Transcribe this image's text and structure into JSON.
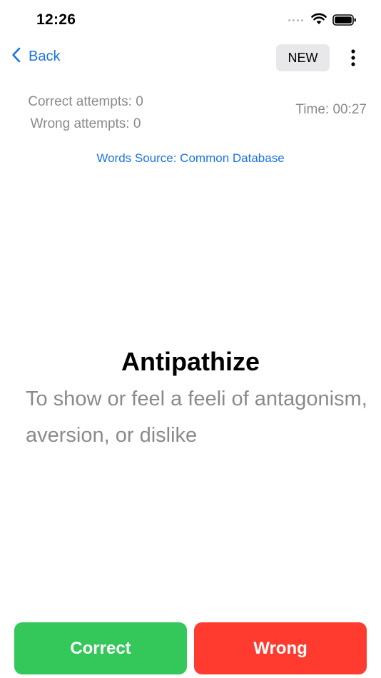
{
  "status_bar": {
    "time": "12:26",
    "icons": [
      "signal-icon",
      "wifi-icon",
      "battery-icon"
    ]
  },
  "nav": {
    "back_label": "Back",
    "new_label": "NEW",
    "more_icon": "more-vertical-icon"
  },
  "stats": {
    "correct_attempts": "Correct attempts: 0",
    "wrong_attempts": "Wrong attempts: 0",
    "time": "Time: 00:27"
  },
  "source": {
    "label": "Words Source: Common Database"
  },
  "card": {
    "word": "Antipathize",
    "definition": "To show or feel a feeli of antagonism, aversion, or dislike"
  },
  "actions": {
    "correct_label": "Correct",
    "wrong_label": "Wrong"
  },
  "colors": {
    "accent": "#1a73e8",
    "correct": "#34c759",
    "wrong": "#ff3b30",
    "secondary_text": "#8a8a8e"
  }
}
